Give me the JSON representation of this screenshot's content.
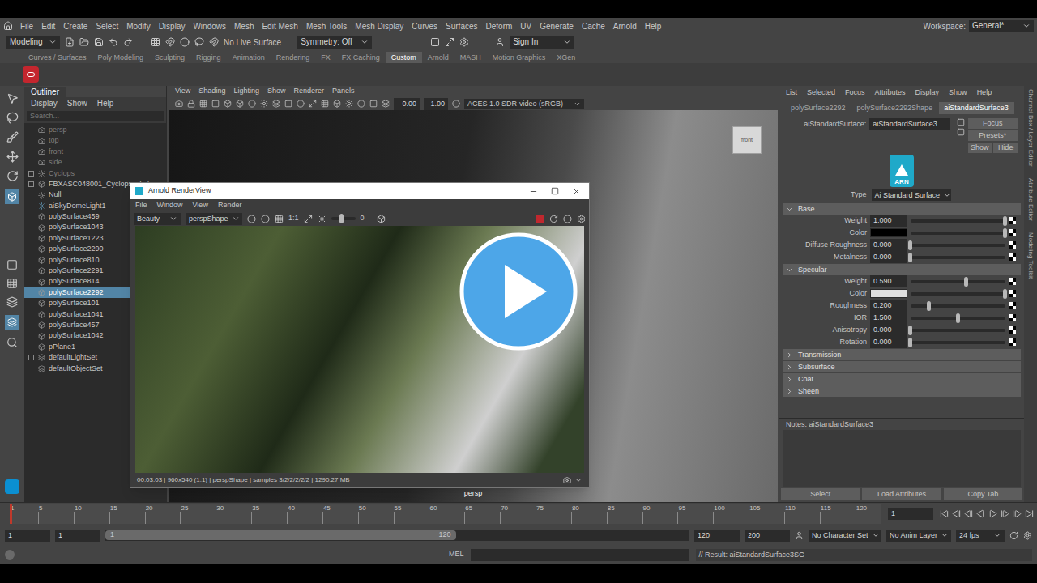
{
  "menu_bar": {
    "items": [
      "File",
      "Edit",
      "Create",
      "Select",
      "Modify",
      "Display",
      "Windows",
      "Mesh",
      "Edit Mesh",
      "Mesh Tools",
      "Mesh Display",
      "Curves",
      "Surfaces",
      "Deform",
      "UV",
      "Generate",
      "Cache",
      "Arnold",
      "Help"
    ],
    "workspace_label": "Workspace:",
    "workspace": "General*"
  },
  "status_line": {
    "mode": "Modeling",
    "live_surface": "No Live Surface",
    "symmetry": "Symmetry: Off",
    "sign_in": "Sign In"
  },
  "shelf": {
    "tabs": [
      {
        "label": "Curves / Surfaces",
        "selected": false
      },
      {
        "label": "Poly Modeling",
        "selected": false
      },
      {
        "label": "Sculpting",
        "selected": false
      },
      {
        "label": "Rigging",
        "selected": false
      },
      {
        "label": "Animation",
        "selected": false
      },
      {
        "label": "Rendering",
        "selected": false
      },
      {
        "label": "FX",
        "selected": false
      },
      {
        "label": "FX Caching",
        "selected": false
      },
      {
        "label": "Custom",
        "selected": true
      },
      {
        "label": "Arnold",
        "selected": false
      },
      {
        "label": "MASH",
        "selected": false
      },
      {
        "label": "Motion Graphics",
        "selected": false
      },
      {
        "label": "XGen",
        "selected": false
      }
    ]
  },
  "outliner": {
    "title": "Outliner",
    "menus": [
      "Display",
      "Show",
      "Help"
    ],
    "search": "Search...",
    "items": [
      {
        "label": "persp",
        "kind": "camera",
        "greyed": true,
        "expandable": false,
        "selected": false
      },
      {
        "label": "top",
        "kind": "camera",
        "greyed": true,
        "expandable": false,
        "selected": false
      },
      {
        "label": "front",
        "kind": "camera",
        "greyed": true,
        "expandable": false,
        "selected": false
      },
      {
        "label": "side",
        "kind": "camera",
        "greyed": true,
        "expandable": false,
        "selected": false
      },
      {
        "label": "Cyclops",
        "kind": "joint",
        "greyed": true,
        "expandable": true,
        "selected": false
      },
      {
        "label": "FBXASC048001_Cyclops_skel",
        "kind": "mesh",
        "greyed": false,
        "expandable": true,
        "selected": false
      },
      {
        "label": "Null",
        "kind": "joint",
        "greyed": false,
        "expandable": false,
        "selected": false
      },
      {
        "label": "aiSkyDomeLight1",
        "kind": "light",
        "greyed": false,
        "expandable": false,
        "selected": false
      },
      {
        "label": "polySurface459",
        "kind": "mesh",
        "greyed": false,
        "expandable": false,
        "selected": false
      },
      {
        "label": "polySurface1043",
        "kind": "mesh",
        "greyed": false,
        "expandable": false,
        "selected": false
      },
      {
        "label": "polySurface1223",
        "kind": "mesh",
        "greyed": false,
        "expandable": false,
        "selected": false
      },
      {
        "label": "polySurface2290",
        "kind": "mesh",
        "greyed": false,
        "expandable": false,
        "selected": false
      },
      {
        "label": "polySurface810",
        "kind": "mesh",
        "greyed": false,
        "expandable": false,
        "selected": false
      },
      {
        "label": "polySurface2291",
        "kind": "mesh",
        "greyed": false,
        "expandable": false,
        "selected": false
      },
      {
        "label": "polySurface814",
        "kind": "mesh",
        "greyed": false,
        "expandable": false,
        "selected": false
      },
      {
        "label": "polySurface2292",
        "kind": "mesh",
        "greyed": false,
        "expandable": false,
        "selected": true
      },
      {
        "label": "polySurface101",
        "kind": "mesh",
        "greyed": false,
        "expandable": false,
        "selected": false
      },
      {
        "label": "polySurface1041",
        "kind": "mesh",
        "greyed": false,
        "expandable": false,
        "selected": false
      },
      {
        "label": "polySurface457",
        "kind": "mesh",
        "greyed": false,
        "expandable": false,
        "selected": false
      },
      {
        "label": "polySurface1042",
        "kind": "mesh",
        "greyed": false,
        "expandable": false,
        "selected": false
      },
      {
        "label": "pPlane1",
        "kind": "mesh",
        "greyed": false,
        "expandable": false,
        "selected": false
      },
      {
        "label": "defaultLightSet",
        "kind": "set",
        "greyed": false,
        "expandable": true,
        "selected": false
      },
      {
        "label": "defaultObjectSet",
        "kind": "set",
        "greyed": false,
        "expandable": false,
        "selected": false
      }
    ]
  },
  "viewport": {
    "menus": [
      "View",
      "Shading",
      "Lighting",
      "Show",
      "Renderer",
      "Panels"
    ],
    "fields": [
      "0.00",
      "1.00"
    ],
    "color_space": "ACES 1.0 SDR-video (sRGB)",
    "camera": "persp",
    "view_cube": "front"
  },
  "render_view": {
    "title": "Arnold RenderView",
    "menus": [
      "File",
      "Window",
      "View",
      "Render"
    ],
    "aov": "Beauty",
    "camera": "perspShape",
    "zoom": "1:1",
    "exposure": "0",
    "exposure_level": 0.45,
    "status": "00:03:03 | 960x540 (1:1) | perspShape | samples 3/2/2/2/2/2 | 1290.27 MB"
  },
  "attribute_editor": {
    "menus": [
      "List",
      "Selected",
      "Focus",
      "Attributes",
      "Display",
      "Show",
      "Help"
    ],
    "tabs": [
      {
        "label": "polySurface2292",
        "selected": false
      },
      {
        "label": "polySurface2292Shape",
        "selected": false
      },
      {
        "label": "aiStandardSurface3",
        "selected": true
      }
    ],
    "node_label": "aiStandardSurface:",
    "node_name": "aiStandardSurface3",
    "buttons": [
      "Focus",
      "Presets*",
      "Show",
      "Hide"
    ],
    "logo": "ARN",
    "type_label": "Type",
    "type": "Ai Standard Surface",
    "sections": [
      {
        "title": "Base",
        "expanded": true,
        "attrs": [
          {
            "label": "Weight",
            "kind": "slider",
            "value": "1.000",
            "level": 1.0
          },
          {
            "label": "Color",
            "kind": "color",
            "color": "#000000",
            "level": 1.0
          },
          {
            "label": "Diffuse Roughness",
            "kind": "slider",
            "value": "0.000",
            "level": 0.0
          },
          {
            "label": "Metalness",
            "kind": "slider",
            "value": "0.000",
            "level": 0.0
          }
        ]
      },
      {
        "title": "Specular",
        "expanded": true,
        "attrs": [
          {
            "label": "Weight",
            "kind": "slider",
            "value": "0.590",
            "level": 0.59
          },
          {
            "label": "Color",
            "kind": "color",
            "color": "#e0e0e0",
            "level": 1.0
          },
          {
            "label": "Roughness",
            "kind": "slider",
            "value": "0.200",
            "level": 0.2
          },
          {
            "label": "IOR",
            "kind": "slider",
            "value": "1.500",
            "level": 0.5
          },
          {
            "label": "Anisotropy",
            "kind": "slider",
            "value": "0.000",
            "level": 0.0
          },
          {
            "label": "Rotation",
            "kind": "slider",
            "value": "0.000",
            "level": 0.0
          }
        ]
      },
      {
        "title": "Transmission",
        "expanded": false,
        "attrs": []
      },
      {
        "title": "Subsurface",
        "expanded": false,
        "attrs": []
      },
      {
        "title": "Coat",
        "expanded": false,
        "attrs": []
      },
      {
        "title": "Sheen",
        "expanded": false,
        "attrs": []
      }
    ],
    "notes": "Notes: aiStandardSurface3",
    "footer_buttons": [
      "Select",
      "Load Attributes",
      "Copy Tab"
    ]
  },
  "side_tabs": [
    "Channel Box / Layer Editor",
    "Attribute Editor",
    "Modeling Toolkit"
  ],
  "timeline": {
    "ticks": [
      "1",
      "5",
      "10",
      "15",
      "20",
      "25",
      "30",
      "35",
      "40",
      "45",
      "50",
      "55",
      "60",
      "65",
      "70",
      "75",
      "80",
      "85",
      "90",
      "95",
      "100",
      "105",
      "110",
      "115",
      "120"
    ],
    "min": 1,
    "max": 120,
    "current_frame": "1",
    "level": 0.0
  },
  "range": {
    "start": "1",
    "range_start": "1",
    "range_start_label": "1",
    "range_end_label": "120",
    "range_end": "120",
    "end": "200",
    "level": 0.6,
    "character_set": "No Character Set",
    "anim_layer": "No Anim Layer",
    "fps": "24 fps"
  },
  "command_line": {
    "lang": "MEL",
    "result": "// Result: aiStandardSurface3SG"
  }
}
